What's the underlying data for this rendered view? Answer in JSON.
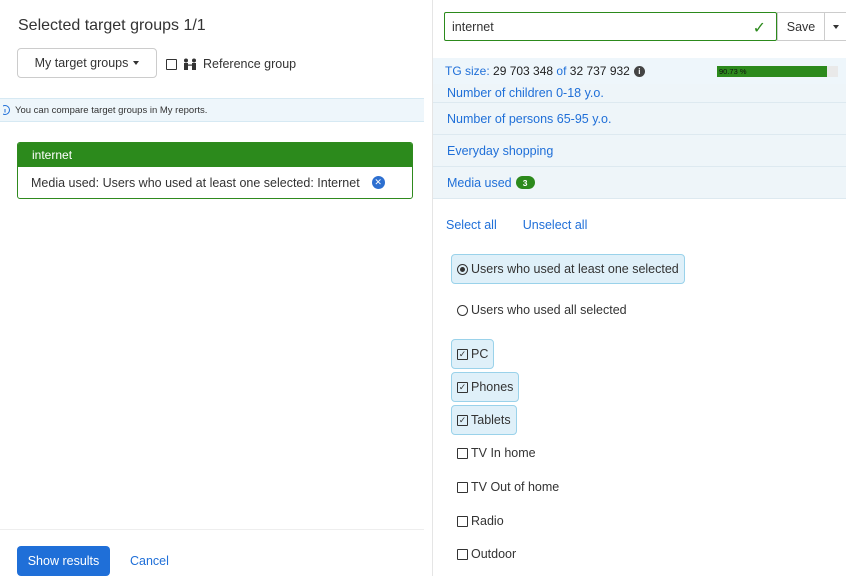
{
  "left": {
    "title": "Selected target groups 1/1",
    "my_target_groups_label": "My target groups",
    "reference_group_label": "Reference group",
    "info_text": "You can compare target groups in My reports.",
    "target_group": {
      "name": "internet",
      "condition": "Media used: Users who used at least one selected: Internet"
    },
    "show_results_label": "Show results",
    "cancel_label": "Cancel"
  },
  "right": {
    "search_value": "internet",
    "save_label": "Save",
    "tg_size_label": "TG size:",
    "tg_size_value": "29 703 348",
    "tg_size_of": "of",
    "tg_size_total": "32 737 932",
    "progress_percent": 90.73,
    "progress_label": "90.73 %",
    "categories": [
      "Number of children 0-18 y.o.",
      "Number of persons 65-95 y.o.",
      "Everyday shopping"
    ],
    "media_used_label": "Media used",
    "media_used_count": "3",
    "select_all_label": "Select all",
    "unselect_all_label": "Unselect all",
    "mode_options": [
      "Users who used at least one selected",
      "Users who used all selected"
    ],
    "media_options": [
      {
        "label": "PC",
        "checked": true
      },
      {
        "label": "Phones",
        "checked": true
      },
      {
        "label": "Tablets",
        "checked": true
      },
      {
        "label": "TV In home",
        "checked": false
      },
      {
        "label": "TV Out of home",
        "checked": false
      },
      {
        "label": "Radio",
        "checked": false
      },
      {
        "label": "Outdoor",
        "checked": false
      }
    ],
    "colors": {
      "accent_green": "#2c8a1c",
      "link_blue": "#1f6fd8"
    }
  }
}
